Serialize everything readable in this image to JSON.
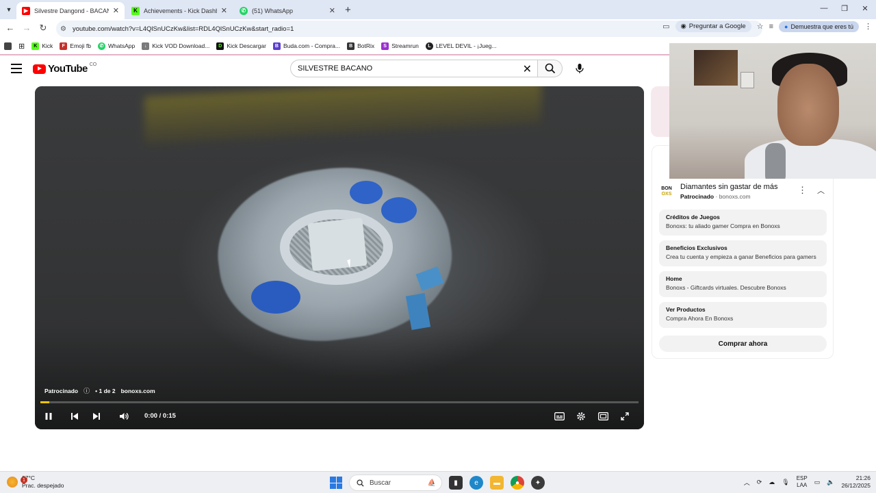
{
  "browser": {
    "tabs": [
      {
        "title": "Silvestre Dangond - BACAN",
        "active": true,
        "favicon": "youtube-icon"
      },
      {
        "title": "Achievements - Kick Dashboard",
        "active": false,
        "favicon": "kick-icon"
      },
      {
        "title": "(51) WhatsApp",
        "active": false,
        "favicon": "whatsapp-icon"
      }
    ],
    "url": "youtube.com/watch?v=L4QlSnUCzKw&list=RDL4QlSnUCzKw&start_radio=1",
    "ask_google": "Preguntar a Google",
    "profile_pill": "Demuestra que eres tú"
  },
  "bookmarks": [
    {
      "label": "Kick",
      "color": "#53fc18",
      "glyph": "K"
    },
    {
      "label": "Emoji fb",
      "color": "#c4302b",
      "glyph": "F"
    },
    {
      "label": "WhatsApp",
      "color": "#25d366",
      "glyph": "W"
    },
    {
      "label": "Kick VOD Download...",
      "color": "#7a7a7a",
      "glyph": "↓"
    },
    {
      "label": "Kick Descargar",
      "color": "#111",
      "glyph": "D"
    },
    {
      "label": "Buda.com - Compra...",
      "color": "#5b3ecf",
      "glyph": "B"
    },
    {
      "label": "BotRix",
      "color": "#333",
      "glyph": "B"
    },
    {
      "label": "Streamrun",
      "color": "#9b2fd1",
      "glyph": "S"
    },
    {
      "label": "LEVEL DEVIL - ¡Jueg...",
      "color": "#222",
      "glyph": "L"
    }
  ],
  "youtube": {
    "logo_word": "YouTube",
    "country": "CO",
    "search_value": "SILVESTRE BACANO"
  },
  "player": {
    "ad_label": "Patrocinado",
    "ad_count": "• 1 de 2",
    "ad_domain": "bonoxs.com",
    "time": "0:00 / 0:15",
    "progress": 0.015
  },
  "sidebar_ad": {
    "logo_top": "BON",
    "logo_bottom": "OXS",
    "title": "Diamantes sin gastar de más",
    "sponsored": "Patrocinado",
    "domain": "· bonoxs.com",
    "sitelinks": [
      {
        "title": "Créditos de Juegos",
        "desc": "Bonoxs: tu aliado gamer Compra en Bonoxs"
      },
      {
        "title": "Beneficios Exclusivos",
        "desc": "Crea tu cuenta y empieza a ganar Beneficios para gamers"
      },
      {
        "title": "Home",
        "desc": "Bonoxs - Giftcards virtuales. Descubre Bonoxs"
      },
      {
        "title": "Ver Productos",
        "desc": "Compra Ahora En Bonoxs"
      }
    ],
    "cta": "Comprar ahora"
  },
  "taskbar": {
    "weather_temp": "27°C",
    "weather_desc": "Prac. despejado",
    "weather_badge": "1",
    "search_placeholder": "Buscar",
    "lang_top": "ESP",
    "lang_bottom": "LAA",
    "time": "21:26",
    "date": "26/12/2025"
  }
}
